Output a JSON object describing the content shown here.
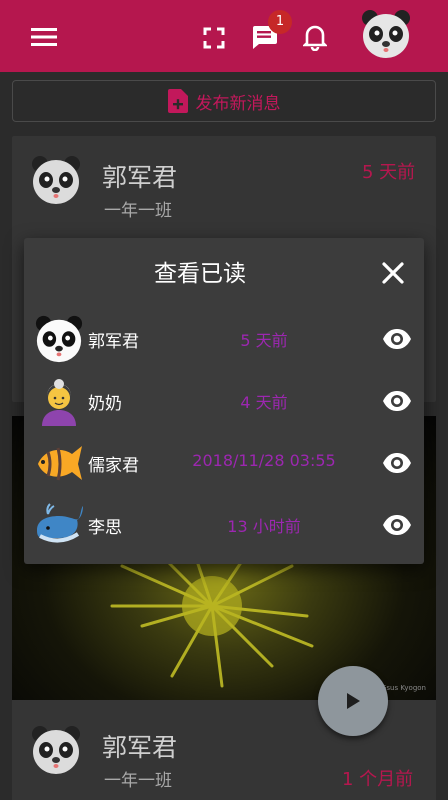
{
  "appbar": {
    "badge_count": "1"
  },
  "compose": {
    "label": "发布新消息"
  },
  "posts": [
    {
      "name": "郭军君",
      "class": "一年一班",
      "time": "5 天前"
    },
    {
      "name": "郭军君",
      "class": "一年一班",
      "time": "1 个月前"
    }
  ],
  "photo": {
    "watermark": "Gsus Kyogon"
  },
  "read_dialog": {
    "title": "查看已读",
    "readers": [
      {
        "name": "郭军君",
        "time": "5 天前",
        "avatar": "panda-icon"
      },
      {
        "name": "奶奶",
        "time": "4 天前",
        "avatar": "grandmother-icon"
      },
      {
        "name": "儒家君",
        "time": "2018/11/28 03:55",
        "avatar": "tropical-fish-icon"
      },
      {
        "name": "李思",
        "time": "13 小时前",
        "avatar": "whale-icon"
      }
    ]
  },
  "colors": {
    "appbar": "#b5174e",
    "accent": "#c2185b",
    "read_time": "#9c27b0"
  }
}
